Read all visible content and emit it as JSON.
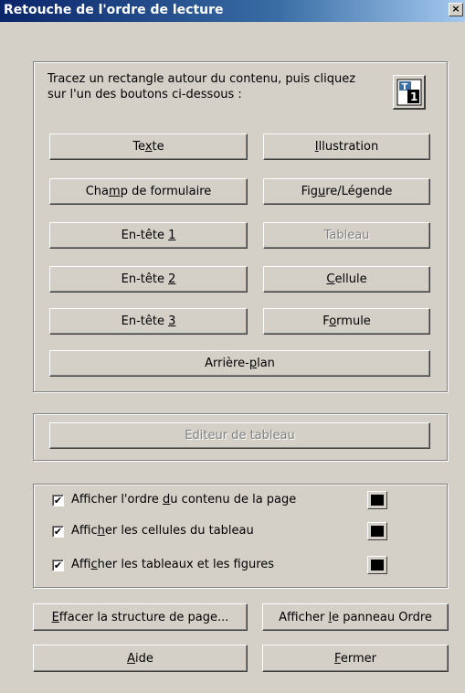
{
  "window": {
    "title": "Retouche de l'ordre de lecture",
    "close_glyph": "×"
  },
  "instructions": "Tracez un rectangle autour du contenu, puis cliquez sur l'un des boutons ci-dessous :",
  "icon_button": {
    "icon": "reading-order-tool-icon",
    "label_letter": "T",
    "label_number": "1"
  },
  "tag_buttons": {
    "text": {
      "pre": "Te",
      "key": "x",
      "post": "te"
    },
    "illustration": {
      "pre": "",
      "key": "I",
      "post": "llustration"
    },
    "form_field": {
      "pre": "Cha",
      "key": "m",
      "post": "p de formulaire"
    },
    "figure_caption": {
      "pre": "Fig",
      "key": "u",
      "post": "re/Légende"
    },
    "heading1": {
      "pre": "En-tête ",
      "key": "1",
      "post": ""
    },
    "table": {
      "label": "Tableau",
      "disabled": true
    },
    "heading2": {
      "pre": "En-tête ",
      "key": "2",
      "post": ""
    },
    "cell": {
      "pre": "",
      "key": "C",
      "post": "ellule"
    },
    "heading3": {
      "pre": "En-tête ",
      "key": "3",
      "post": ""
    },
    "formula": {
      "pre": "F",
      "key": "o",
      "post": "rmule"
    },
    "background": {
      "pre": "Arrière-",
      "key": "p",
      "post": "lan"
    }
  },
  "table_editor": {
    "label": "Editeur de tableau",
    "disabled": true
  },
  "options": [
    {
      "pre": "Afficher l'ordre ",
      "key": "d",
      "post": "u contenu de la page",
      "checked": true,
      "color": "#000000"
    },
    {
      "pre": "Affic",
      "key": "h",
      "post": "er les cellules du tableau",
      "checked": true,
      "color": "#000000"
    },
    {
      "pre": "Affi",
      "key": "c",
      "post": "her les tableaux et les figures",
      "checked": true,
      "color": "#000000"
    }
  ],
  "bottom_buttons": {
    "clear_structure": {
      "pre": "",
      "key": "E",
      "post": "ffacer la structure de page..."
    },
    "show_order_panel": {
      "pre": "Afficher ",
      "key": "l",
      "post": "e panneau Ordre"
    },
    "help": {
      "pre": "",
      "key": "A",
      "post": "ide"
    },
    "close": {
      "pre": "",
      "key": "F",
      "post": "ermer"
    }
  },
  "check_glyph": "✔"
}
